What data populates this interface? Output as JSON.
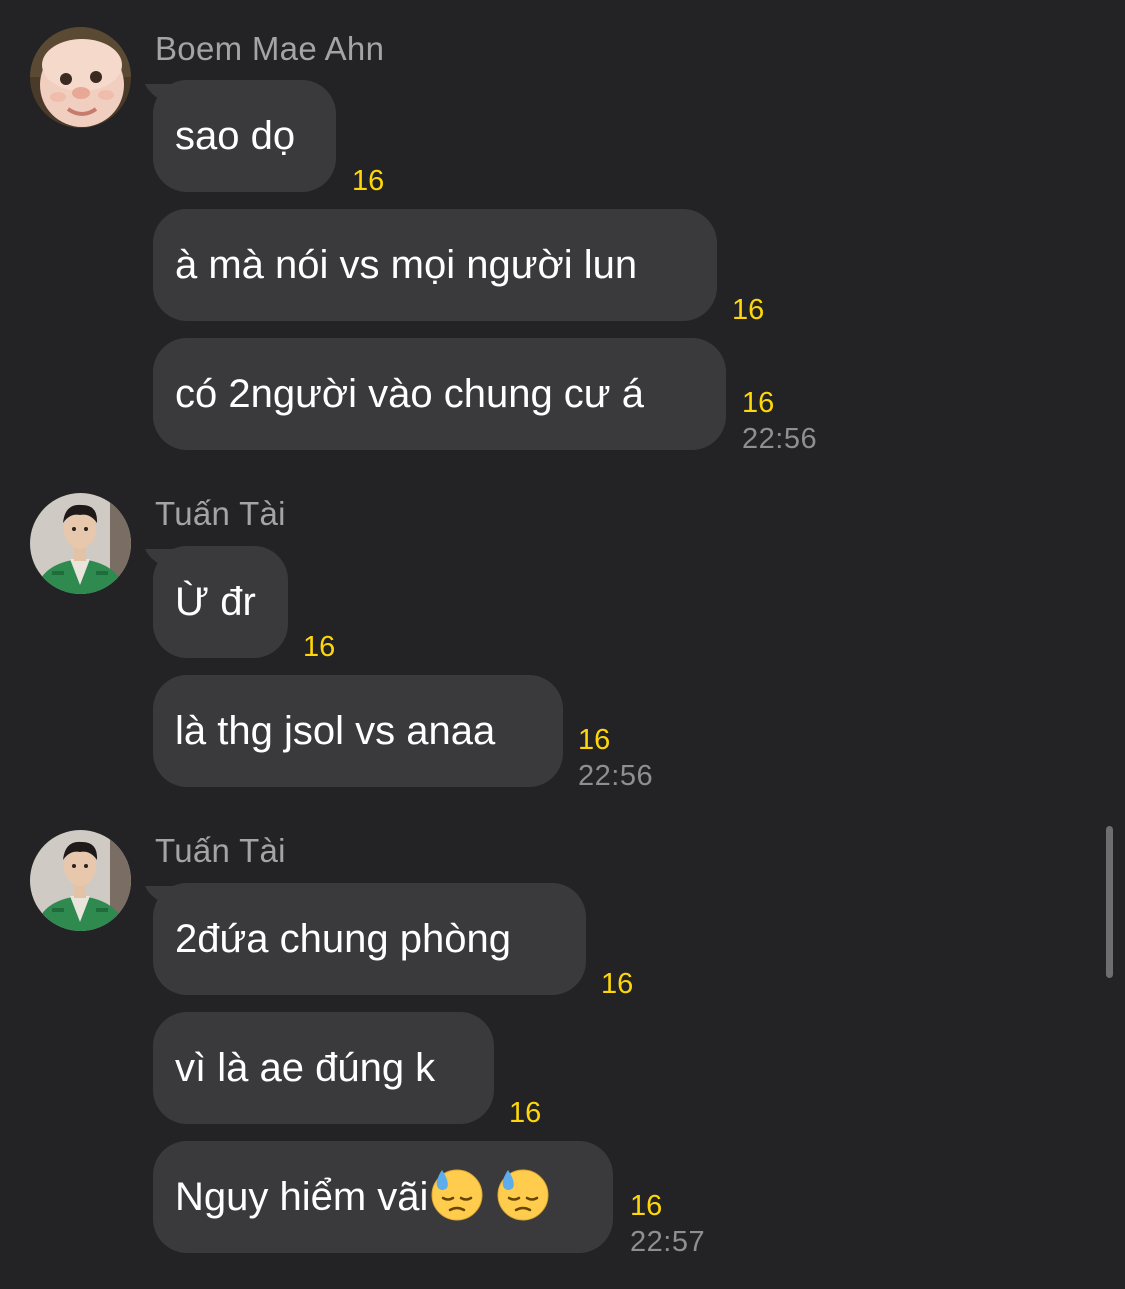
{
  "conversation": {
    "groups": [
      {
        "sender": "Boem Mae Ahn",
        "avatar_icon": "baby-face-avatar",
        "messages": [
          {
            "text": "sao dọ",
            "count": "16"
          },
          {
            "text": "à mà nói vs mọi người lun",
            "count": "16"
          },
          {
            "text": "có 2người vào chung cư á",
            "count": "16",
            "time": "22:56"
          }
        ]
      },
      {
        "sender": "Tuấn Tài",
        "avatar_icon": "man-green-jacket-avatar",
        "messages": [
          {
            "text": "Ừ đr",
            "count": "16"
          },
          {
            "text": "là thg jsol vs anaa",
            "count": "16",
            "time": "22:56"
          }
        ]
      },
      {
        "sender": "Tuấn Tài",
        "avatar_icon": "man-green-jacket-avatar",
        "messages": [
          {
            "text": "2đứa chung phòng",
            "count": "16"
          },
          {
            "text": "vì là ae đúng k",
            "count": "16"
          },
          {
            "text": "Nguy hiểm vãi",
            "emojis": [
              "downcast-face-with-sweat-emoji",
              "downcast-face-with-sweat-emoji"
            ],
            "count": "16",
            "time": "22:57"
          }
        ]
      }
    ]
  },
  "colors": {
    "background": "#232325",
    "bubble": "#3a3a3c",
    "sender_name": "#a3a3a8",
    "reaction_count": "#ffd60a",
    "timestamp": "#8e8e93"
  }
}
